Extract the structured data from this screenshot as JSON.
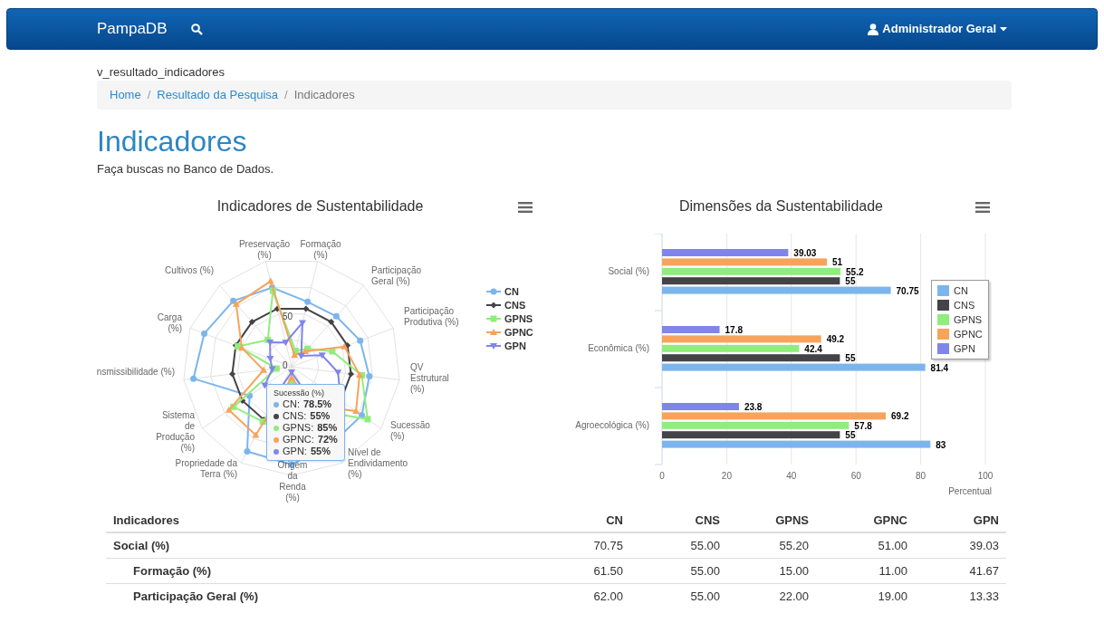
{
  "navbar": {
    "brand": "PampaDB",
    "user": "Administrador Geral"
  },
  "page_id": "v_resultado_indicadores",
  "breadcrumb": {
    "separator": "/",
    "items": [
      {
        "label": "Home",
        "link": true
      },
      {
        "label": "Resultado da Pesquisa",
        "link": true
      },
      {
        "label": "Indicadores",
        "link": false
      }
    ]
  },
  "heading": "Indicadores",
  "subtitle": "Faça buscas no Banco de Dados.",
  "radar": {
    "title": "Indicadores de Sustentabilidade",
    "axis_labels": [
      "Preservação (%)",
      "Formação (%)",
      "Cultivos (%)",
      "Participação Geral (%)",
      "Carga (%)",
      "Participação Produtiva (%)",
      "nsmissibilidade (%)",
      "QV Estrutural (%)",
      "Sistema de Produção (%)",
      "Sucessão (%)",
      "Propriedade da Terra (%)",
      "Nível de Endividamento (%)",
      "Origem da Renda (%)"
    ],
    "tick_labels": [
      "50",
      "0"
    ],
    "legend": [
      {
        "name": "CN",
        "color": "#7cb5ec"
      },
      {
        "name": "CNS",
        "color": "#434348"
      },
      {
        "name": "GPNS",
        "color": "#90ed7d"
      },
      {
        "name": "GPNC",
        "color": "#f7a35c"
      },
      {
        "name": "GPN",
        "color": "#8085e9"
      }
    ],
    "tooltip": {
      "title": "Sucessão (%)",
      "rows": [
        {
          "name": "CN:",
          "value": "78.5%"
        },
        {
          "name": "CNS:",
          "value": "55%"
        },
        {
          "name": "GPNS:",
          "value": "85%"
        },
        {
          "name": "GPNC:",
          "value": "72%"
        },
        {
          "name": "GPN:",
          "value": "55%"
        }
      ]
    }
  },
  "bars": {
    "title": "Dimensões da Sustentabilidade",
    "chart_data": {
      "type": "bar",
      "orientation": "horizontal",
      "grid": true,
      "categories": [
        "Social (%)",
        "Econômica (%)",
        "Agroecológica (%)"
      ],
      "xlabel": "Percentual",
      "xlim": [
        0,
        100
      ],
      "xticks": [
        0,
        20,
        40,
        60,
        80,
        100
      ],
      "series": [
        {
          "name": "CN",
          "color": "#7cb5ec",
          "values": [
            70.75,
            81.4,
            83
          ],
          "value_labels": [
            "70.75",
            "81.4",
            "83"
          ]
        },
        {
          "name": "CNS",
          "color": "#434348",
          "values": [
            55,
            55,
            55
          ],
          "value_labels": [
            "55",
            "55",
            "55"
          ]
        },
        {
          "name": "GPNS",
          "color": "#90ed7d",
          "values": [
            55.2,
            42.4,
            57.8
          ],
          "value_labels": [
            "55.2",
            "42.4",
            "57.8"
          ]
        },
        {
          "name": "GPNC",
          "color": "#f7a35c",
          "values": [
            51,
            49.2,
            69.2
          ],
          "value_labels": [
            "51",
            "49.2",
            "69.2"
          ]
        },
        {
          "name": "GPN",
          "color": "#8085e9",
          "values": [
            39.03,
            17.8,
            23.8
          ],
          "value_labels": [
            "39.03",
            "17.8",
            "23.8"
          ]
        }
      ]
    }
  },
  "table": {
    "columns": [
      "Indicadores",
      "CN",
      "CNS",
      "GPNS",
      "GPNC",
      "GPN"
    ],
    "rows": [
      {
        "label": "Social (%)",
        "values": [
          "70.75",
          "55.00",
          "55.20",
          "51.00",
          "39.03"
        ],
        "children": [
          {
            "label": "Formação (%)",
            "values": [
              "61.50",
              "55.00",
              "15.00",
              "11.00",
              "41.67"
            ]
          },
          {
            "label": "Participação Geral (%)",
            "values": [
              "62.00",
              "55.00",
              "22.00",
              "19.00",
              "13.33"
            ]
          }
        ]
      }
    ]
  }
}
